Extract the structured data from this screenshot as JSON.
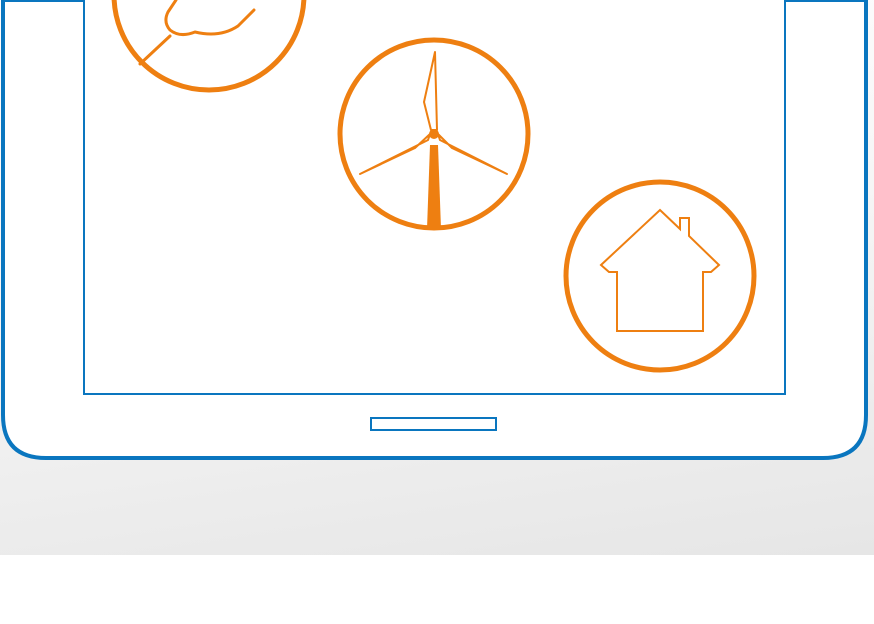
{
  "colors": {
    "device_outline": "#0a76bf",
    "icon_accent": "#ee7f11",
    "device_fill": "#ffffff",
    "backdrop_light": "#f6f6f6",
    "backdrop_dark": "#e6e6e6"
  },
  "icons": [
    {
      "name": "bulb-icon",
      "label": "light-bulb"
    },
    {
      "name": "wind-turbine-icon",
      "label": "wind-turbine"
    },
    {
      "name": "house-icon",
      "label": "house"
    }
  ],
  "device": {
    "type": "tablet",
    "home_button": "home-button"
  }
}
